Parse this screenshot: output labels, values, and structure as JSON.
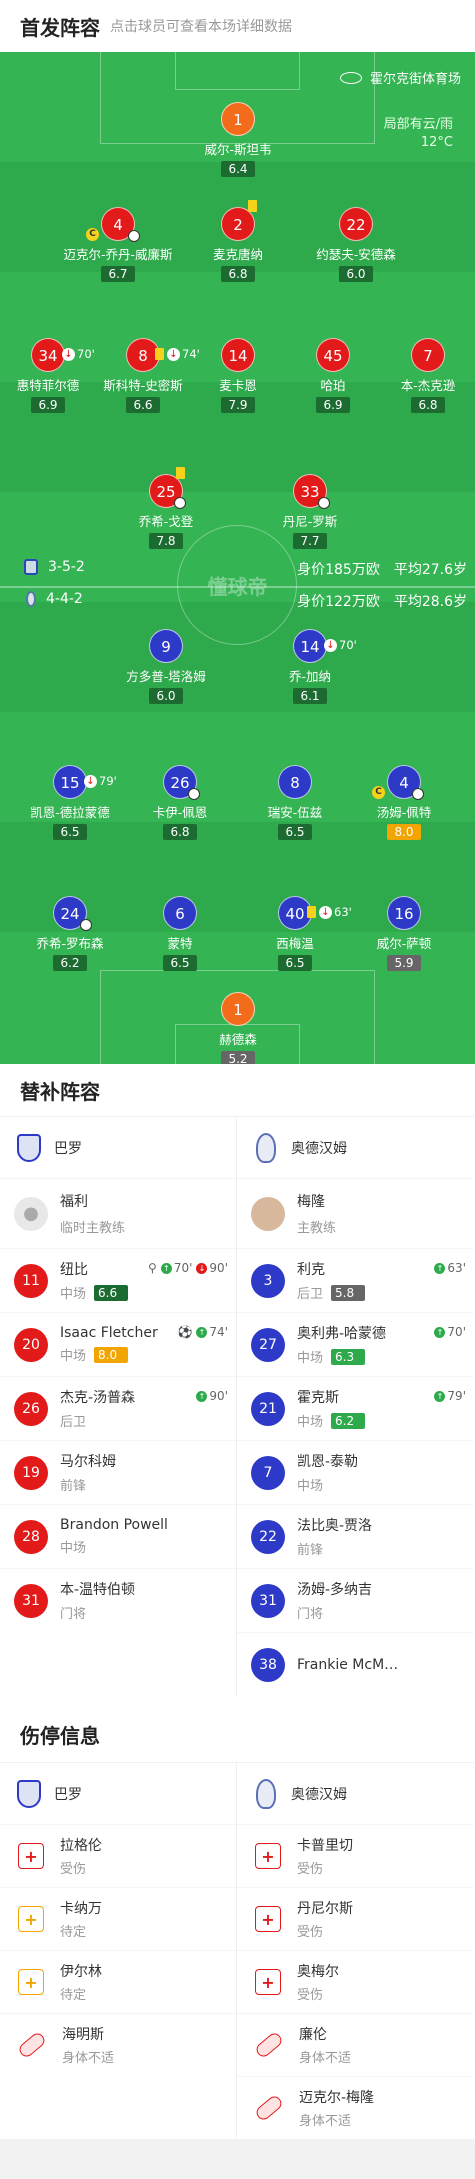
{
  "lineup_header": {
    "title": "首发阵容",
    "subtitle": "点击球员可查看本场详细数据"
  },
  "venue": {
    "name": "霍尔克街体育场",
    "weather": "局部有云/雨",
    "temp": "12°C"
  },
  "watermark": "懂球帝",
  "home": {
    "formation": "3-5-2",
    "value": "身价185万欧",
    "age": "平均27.6岁",
    "players": [
      {
        "num": "1",
        "name": "威尔-斯坦韦",
        "rating": "6.4"
      },
      {
        "num": "4",
        "name": "迈克尔-乔丹-威廉斯",
        "rating": "6.7",
        "captain": "C"
      },
      {
        "num": "2",
        "name": "麦克唐纳",
        "rating": "6.8"
      },
      {
        "num": "22",
        "name": "约瑟夫-安德森",
        "rating": "6.0"
      },
      {
        "num": "34",
        "name": "惠特菲尔德",
        "rating": "6.9",
        "sub_min": "70'"
      },
      {
        "num": "8",
        "name": "斯科特-史密斯",
        "rating": "6.6",
        "sub_min": "74'"
      },
      {
        "num": "14",
        "name": "麦卡恩",
        "rating": "7.9"
      },
      {
        "num": "45",
        "name": "哈珀",
        "rating": "6.9"
      },
      {
        "num": "7",
        "name": "本-杰克逊",
        "rating": "6.8"
      },
      {
        "num": "25",
        "name": "乔希-戈登",
        "rating": "7.8"
      },
      {
        "num": "33",
        "name": "丹尼-罗斯",
        "rating": "7.7"
      }
    ]
  },
  "away": {
    "formation": "4-4-2",
    "value": "身价122万欧",
    "age": "平均28.6岁",
    "players": [
      {
        "num": "9",
        "name": "方多普-塔洛姆",
        "rating": "6.0"
      },
      {
        "num": "14",
        "name": "乔-加纳",
        "rating": "6.1",
        "sub_min": "70'"
      },
      {
        "num": "15",
        "name": "凯恩-德拉蒙德",
        "rating": "6.5",
        "sub_min": "79'"
      },
      {
        "num": "26",
        "name": "卡伊-佩恩",
        "rating": "6.8"
      },
      {
        "num": "8",
        "name": "瑞安-伍兹",
        "rating": "6.5"
      },
      {
        "num": "4",
        "name": "汤姆-佩特",
        "rating": "8.0",
        "captain": "C"
      },
      {
        "num": "24",
        "name": "乔希-罗布森",
        "rating": "6.2"
      },
      {
        "num": "6",
        "name": "蒙特",
        "rating": "6.5"
      },
      {
        "num": "40",
        "name": "西梅温",
        "rating": "6.5",
        "sub_min": "63'"
      },
      {
        "num": "16",
        "name": "威尔-萨顿",
        "rating": "5.9"
      },
      {
        "num": "1",
        "name": "赫德森",
        "rating": "5.2"
      }
    ]
  },
  "subs_header": {
    "title": "替补阵容"
  },
  "subs": {
    "home_team": "巴罗",
    "away_team": "奥德汉姆",
    "home_coach": {
      "name": "福利",
      "role": "临时主教练"
    },
    "away_coach": {
      "name": "梅隆",
      "role": "主教练"
    },
    "home": [
      {
        "num": "11",
        "name": "纽比",
        "pos": "中场",
        "rating": "6.6",
        "ev1": "70'",
        "ev2": "90'"
      },
      {
        "num": "20",
        "name": "Isaac Fletcher",
        "pos": "中场",
        "rating": "8.0",
        "ev1": "74'"
      },
      {
        "num": "26",
        "name": "杰克-汤普森",
        "pos": "后卫",
        "ev1": "90'"
      },
      {
        "num": "19",
        "name": "马尔科姆",
        "pos": "前锋"
      },
      {
        "num": "28",
        "name": "Brandon Powell",
        "pos": "中场"
      },
      {
        "num": "31",
        "name": "本-温特伯顿",
        "pos": "门将"
      }
    ],
    "away": [
      {
        "num": "3",
        "name": "利克",
        "pos": "后卫",
        "rating": "5.8",
        "ev1": "63'"
      },
      {
        "num": "27",
        "name": "奥利弗-哈蒙德",
        "pos": "中场",
        "rating": "6.3",
        "ev1": "70'"
      },
      {
        "num": "21",
        "name": "霍克斯",
        "pos": "中场",
        "rating": "6.2",
        "ev1": "79'"
      },
      {
        "num": "7",
        "name": "凯恩-泰勒",
        "pos": "中场"
      },
      {
        "num": "22",
        "name": "法比奥-贾洛",
        "pos": "前锋"
      },
      {
        "num": "31",
        "name": "汤姆-多纳吉",
        "pos": "门将"
      },
      {
        "num": "38",
        "name": "Frankie McM…",
        "pos": ""
      }
    ]
  },
  "injury_header": {
    "title": "伤停信息"
  },
  "injuries": {
    "home": [
      {
        "name": "拉格伦",
        "status": "受伤"
      },
      {
        "name": "卡纳万",
        "status": "待定"
      },
      {
        "name": "伊尔林",
        "status": "待定"
      },
      {
        "name": "海明斯",
        "status": "身体不适"
      }
    ],
    "away": [
      {
        "name": "卡普里切",
        "status": "受伤"
      },
      {
        "name": "丹尼尔斯",
        "status": "受伤"
      },
      {
        "name": "奥梅尔",
        "status": "受伤"
      },
      {
        "name": "廉伦",
        "status": "身体不适"
      },
      {
        "name": "迈克尔-梅隆",
        "status": "身体不适"
      }
    ]
  }
}
